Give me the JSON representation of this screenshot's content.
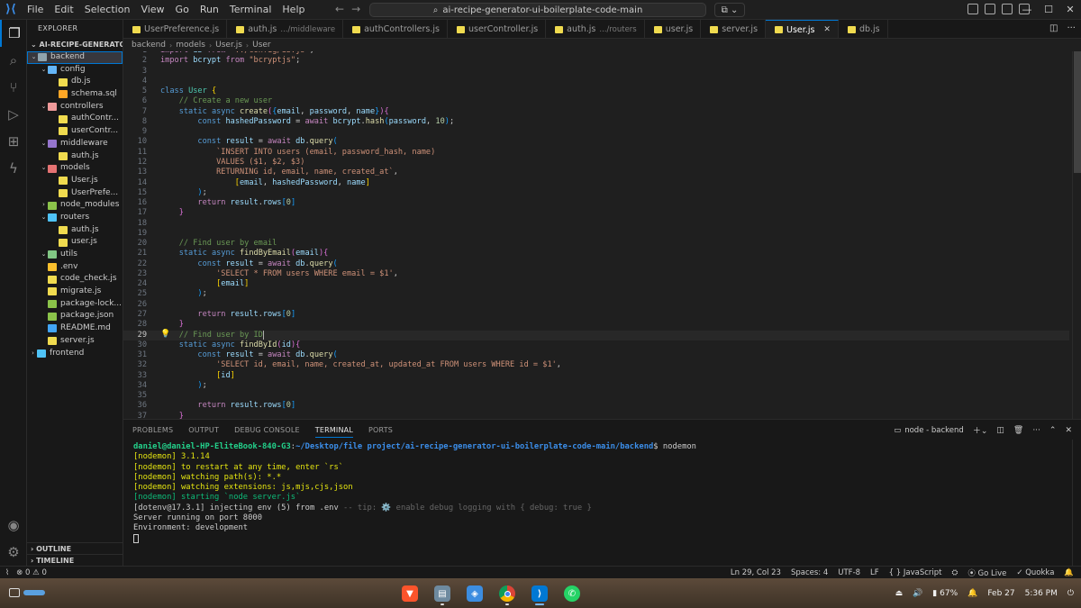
{
  "titlebar": {
    "menu": [
      "File",
      "Edit",
      "Selection",
      "View",
      "Go",
      "Run",
      "Terminal",
      "Help"
    ],
    "search_text": "ai-recipe-generator-ui-boilerplate-code-main"
  },
  "sidebar": {
    "title": "EXPLORER",
    "root": "AI-RECIPE-GENERATOR-...",
    "outline": "OUTLINE",
    "timeline": "TIMELINE",
    "tree": [
      {
        "label": "backend",
        "depth": 0,
        "kind": "folder",
        "open": true,
        "icon": "fi-folder",
        "selected": true
      },
      {
        "label": "config",
        "depth": 1,
        "kind": "folder",
        "open": true,
        "icon": "fi-config"
      },
      {
        "label": "db.js",
        "depth": 2,
        "kind": "file",
        "icon": "fi-js"
      },
      {
        "label": "schema.sql",
        "depth": 2,
        "kind": "file",
        "icon": "fi-sql"
      },
      {
        "label": "controllers",
        "depth": 1,
        "kind": "folder",
        "open": true,
        "icon": "fi-ctrl"
      },
      {
        "label": "authContr...",
        "depth": 2,
        "kind": "file",
        "icon": "fi-js"
      },
      {
        "label": "userContr...",
        "depth": 2,
        "kind": "file",
        "icon": "fi-js"
      },
      {
        "label": "middleware",
        "depth": 1,
        "kind": "folder",
        "open": true,
        "icon": "fi-mid"
      },
      {
        "label": "auth.js",
        "depth": 2,
        "kind": "file",
        "icon": "fi-js"
      },
      {
        "label": "models",
        "depth": 1,
        "kind": "folder",
        "open": true,
        "icon": "fi-models"
      },
      {
        "label": "User.js",
        "depth": 2,
        "kind": "file",
        "icon": "fi-js"
      },
      {
        "label": "UserPrefe...",
        "depth": 2,
        "kind": "file",
        "icon": "fi-js"
      },
      {
        "label": "node_modules",
        "depth": 1,
        "kind": "folder",
        "open": false,
        "icon": "fi-node"
      },
      {
        "label": "routers",
        "depth": 1,
        "kind": "folder",
        "open": true,
        "icon": "fi-routers"
      },
      {
        "label": "auth.js",
        "depth": 2,
        "kind": "file",
        "icon": "fi-js"
      },
      {
        "label": "user.js",
        "depth": 2,
        "kind": "file",
        "icon": "fi-js"
      },
      {
        "label": "utils",
        "depth": 1,
        "kind": "folder",
        "open": true,
        "icon": "fi-utils"
      },
      {
        "label": ".env",
        "depth": 1,
        "kind": "file",
        "icon": "fi-env"
      },
      {
        "label": "code_check.js",
        "depth": 1,
        "kind": "file",
        "icon": "fi-js"
      },
      {
        "label": "migrate.js",
        "depth": 1,
        "kind": "file",
        "icon": "fi-js"
      },
      {
        "label": "package-lock...",
        "depth": 1,
        "kind": "file",
        "icon": "fi-json"
      },
      {
        "label": "package.json",
        "depth": 1,
        "kind": "file",
        "icon": "fi-json"
      },
      {
        "label": "README.md",
        "depth": 1,
        "kind": "file",
        "icon": "fi-md"
      },
      {
        "label": "server.js",
        "depth": 1,
        "kind": "file",
        "icon": "fi-js"
      },
      {
        "label": "frontend",
        "depth": 0,
        "kind": "folder",
        "open": false,
        "icon": "fi-front"
      }
    ]
  },
  "tabs": [
    {
      "label": "UserPreference.js",
      "desc": "",
      "active": false
    },
    {
      "label": "auth.js",
      "desc": ".../middleware",
      "active": false
    },
    {
      "label": "authControllers.js",
      "desc": "",
      "active": false
    },
    {
      "label": "userController.js",
      "desc": "",
      "active": false
    },
    {
      "label": "auth.js",
      "desc": ".../routers",
      "active": false
    },
    {
      "label": "user.js",
      "desc": "",
      "active": false
    },
    {
      "label": "server.js",
      "desc": "",
      "active": false
    },
    {
      "label": "User.js",
      "desc": "",
      "active": true
    },
    {
      "label": "db.js",
      "desc": "",
      "active": false
    }
  ],
  "breadcrumb": [
    "backend",
    "models",
    "User.js",
    "User"
  ],
  "editor": {
    "current_line": 29,
    "lines": [
      [
        1,
        "<span class=\"kw2\">import</span> <span class=\"var\">db</span> <span class=\"kw2\">from</span> <span class=\"str\">\"../config/db.js\"</span>;"
      ],
      [
        2,
        "<span class=\"kw2\">import</span> <span class=\"var\">bcrypt</span> <span class=\"kw2\">from</span> <span class=\"str\">\"bcryptjs\"</span>;"
      ],
      [
        3,
        ""
      ],
      [
        4,
        ""
      ],
      [
        5,
        "<span class=\"kw\">class</span> <span class=\"cls\">User</span> <span class=\"br1\">{</span>"
      ],
      [
        6,
        "    <span class=\"com\">// Create a new user</span>"
      ],
      [
        7,
        "    <span class=\"kw\">static</span> <span class=\"kw\">async</span> <span class=\"fn\">create</span><span class=\"br2\">(</span><span class=\"br3\">{</span><span class=\"var\">email</span>, <span class=\"var\">password</span>, <span class=\"var\">name</span><span class=\"br3\">}</span><span class=\"br2\">)</span><span class=\"br2\">{</span>"
      ],
      [
        8,
        "        <span class=\"kw\">const</span> <span class=\"var\">hashedPassword</span> = <span class=\"kw2\">await</span> <span class=\"var\">bcrypt</span>.<span class=\"fn\">hash</span><span class=\"br3\">(</span><span class=\"var\">password</span>, <span class=\"num\">10</span><span class=\"br3\">)</span>;"
      ],
      [
        9,
        ""
      ],
      [
        10,
        "        <span class=\"kw\">const</span> <span class=\"var\">result</span> = <span class=\"kw2\">await</span> <span class=\"var\">db</span>.<span class=\"fn\">query</span><span class=\"br3\">(</span>"
      ],
      [
        11,
        "            <span class=\"str\">`INSERT INTO users (email, password_hash, name)</span>"
      ],
      [
        12,
        "            <span class=\"str\">VALUES ($1, $2, $3)</span>"
      ],
      [
        13,
        "            <span class=\"str\">RETURNING id, email, name, created_at`</span>,"
      ],
      [
        14,
        "                <span class=\"br1\">[</span><span class=\"var\">email</span>, <span class=\"var\">hashedPassword</span>, <span class=\"var\">name</span><span class=\"br1\">]</span>"
      ],
      [
        15,
        "        <span class=\"br3\">)</span>;"
      ],
      [
        16,
        "        <span class=\"kw2\">return</span> <span class=\"var\">result</span>.<span class=\"var\">rows</span><span class=\"br3\">[</span><span class=\"num\">0</span><span class=\"br3\">]</span>"
      ],
      [
        17,
        "    <span class=\"br2\">}</span>"
      ],
      [
        18,
        ""
      ],
      [
        19,
        ""
      ],
      [
        20,
        "    <span class=\"com\">// Find user by email</span>"
      ],
      [
        21,
        "    <span class=\"kw\">static</span> <span class=\"kw\">async</span> <span class=\"fn\">findByEmail</span><span class=\"br2\">(</span><span class=\"var\">email</span><span class=\"br2\">)</span><span class=\"br2\">{</span>"
      ],
      [
        22,
        "        <span class=\"kw\">const</span> <span class=\"var\">result</span> = <span class=\"kw2\">await</span> <span class=\"var\">db</span>.<span class=\"fn\">query</span><span class=\"br3\">(</span>"
      ],
      [
        23,
        "            <span class=\"str\">'SELECT * FROM users WHERE email = $1'</span>,"
      ],
      [
        24,
        "            <span class=\"br1\">[</span><span class=\"var\">email</span><span class=\"br1\">]</span>"
      ],
      [
        25,
        "        <span class=\"br3\">)</span>;"
      ],
      [
        26,
        ""
      ],
      [
        27,
        "        <span class=\"kw2\">return</span> <span class=\"var\">result</span>.<span class=\"var\">rows</span><span class=\"br3\">[</span><span class=\"num\">0</span><span class=\"br3\">]</span>"
      ],
      [
        28,
        "    <span class=\"br2\">}</span>"
      ],
      [
        29,
        "    <span class=\"com\">// Find user by ID</span><span style=\"border-left:1px solid #aeafad;\"></span>"
      ],
      [
        30,
        "    <span class=\"kw\">static</span> <span class=\"kw\">async</span> <span class=\"fn\">findById</span><span class=\"br2\">(</span><span class=\"var\">id</span><span class=\"br2\">)</span><span class=\"br2\">{</span>"
      ],
      [
        31,
        "        <span class=\"kw\">const</span> <span class=\"var\">result</span> = <span class=\"kw2\">await</span> <span class=\"var\">db</span>.<span class=\"fn\">query</span><span class=\"br3\">(</span>"
      ],
      [
        32,
        "            <span class=\"str\">'SELECT id, email, name, created_at, updated_at FROM users WHERE id = $1'</span>,"
      ],
      [
        33,
        "            <span class=\"br1\">[</span><span class=\"var\">id</span><span class=\"br1\">]</span>"
      ],
      [
        34,
        "        <span class=\"br3\">)</span>;"
      ],
      [
        35,
        ""
      ],
      [
        36,
        "        <span class=\"kw2\">return</span> <span class=\"var\">result</span>.<span class=\"var\">rows</span><span class=\"br3\">[</span><span class=\"num\">0</span><span class=\"br3\">]</span>"
      ],
      [
        37,
        "    <span class=\"br2\">}</span>"
      ]
    ]
  },
  "panel": {
    "tabs": [
      "PROBLEMS",
      "OUTPUT",
      "DEBUG CONSOLE",
      "TERMINAL",
      "PORTS"
    ],
    "active_tab": "TERMINAL",
    "terminal_name": "node - backend",
    "terminal_lines": [
      "<span class=\"t-green\">daniel@daniel-HP-EliteBook-840-G3</span>:<span class=\"t-blue\">~/Desktop/file project/ai-recipe-generator-ui-boilerplate-code-main/backend</span>$ nodemon",
      "<span class=\"t-yellow\">[nodemon] 3.1.14</span>",
      "<span class=\"t-yellow\">[nodemon] to restart at any time, enter `rs`</span>",
      "<span class=\"t-yellow\">[nodemon] watching path(s): *.*</span>",
      "<span class=\"t-yellow\">[nodemon] watching extensions: js,mjs,cjs,json</span>",
      "<span class=\"t-dgreen\">[nodemon] starting `node server.js`</span>",
      "[dotenv@17.3.1] injecting env (5) from .env <span class=\"t-gray\">-- tip: ⚙️ enable debug logging with { debug: true }</span>",
      "Server running on port 8000",
      "Environment: development"
    ]
  },
  "statusbar": {
    "errors": "0",
    "warnings": "0",
    "position": "Ln 29, Col 23",
    "spaces": "Spaces: 4",
    "encoding": "UTF-8",
    "eol": "LF",
    "language": "JavaScript",
    "golive": "Go Live",
    "quokka": "Quokka"
  },
  "taskbar": {
    "battery": "67%",
    "date": "Feb 27",
    "time": "5:36 PM"
  }
}
